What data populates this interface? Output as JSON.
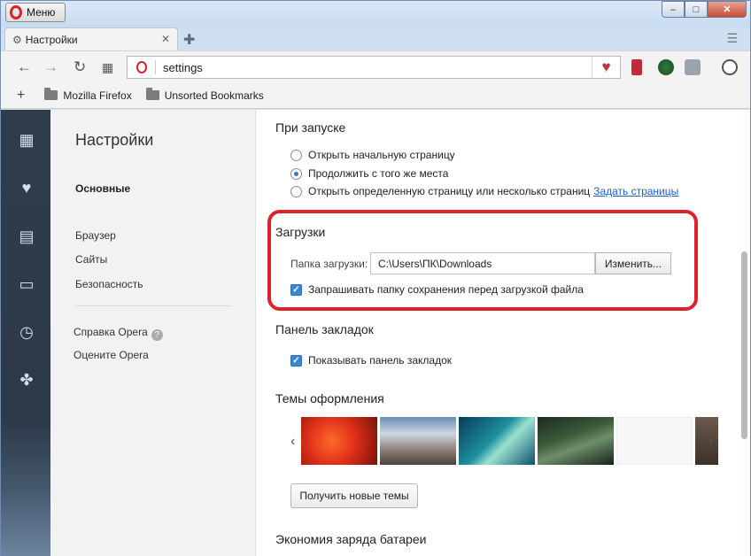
{
  "window": {
    "menu_label": "Меню",
    "controls": {
      "minimize": "–",
      "maximize": "□",
      "close": "✕"
    }
  },
  "tab": {
    "title": "Настройки"
  },
  "address_bar": {
    "url": "settings"
  },
  "bookmarks_bar": {
    "items": [
      "Mozilla Firefox",
      "Unsorted Bookmarks"
    ]
  },
  "sidebar": {
    "title": "Настройки",
    "sections": [
      "Основные",
      "Браузер",
      "Сайты",
      "Безопасность"
    ],
    "active_section": "Основные",
    "links": [
      "Справка Opera",
      "Оцените Opera"
    ]
  },
  "settings": {
    "startup": {
      "heading": "При запуске",
      "options": [
        {
          "label": "Открыть начальную страницу",
          "selected": false
        },
        {
          "label": "Продолжить с того же места",
          "selected": true
        },
        {
          "label": "Открыть определенную страницу или несколько страниц",
          "selected": false
        }
      ],
      "set_pages_link": "Задать страницы"
    },
    "downloads": {
      "heading": "Загрузки",
      "folder_label": "Папка загрузки:",
      "folder_path": "C:\\Users\\ПК\\Downloads",
      "change_button": "Изменить...",
      "ask_checkbox": {
        "label": "Запрашивать папку сохранения перед загрузкой файла",
        "checked": true
      }
    },
    "bookmarks_panel": {
      "heading": "Панель закладок",
      "show_checkbox": {
        "label": "Показывать панель закладок",
        "checked": true
      }
    },
    "themes": {
      "heading": "Темы оформления",
      "get_new_button": "Получить новые темы"
    },
    "battery": {
      "heading": "Экономия заряда батареи"
    }
  },
  "colors": {
    "accent": "#3b86d9",
    "brand_red": "#e0202a",
    "link": "#1a64c8",
    "sidebar_dark": "#2f3c4c"
  }
}
